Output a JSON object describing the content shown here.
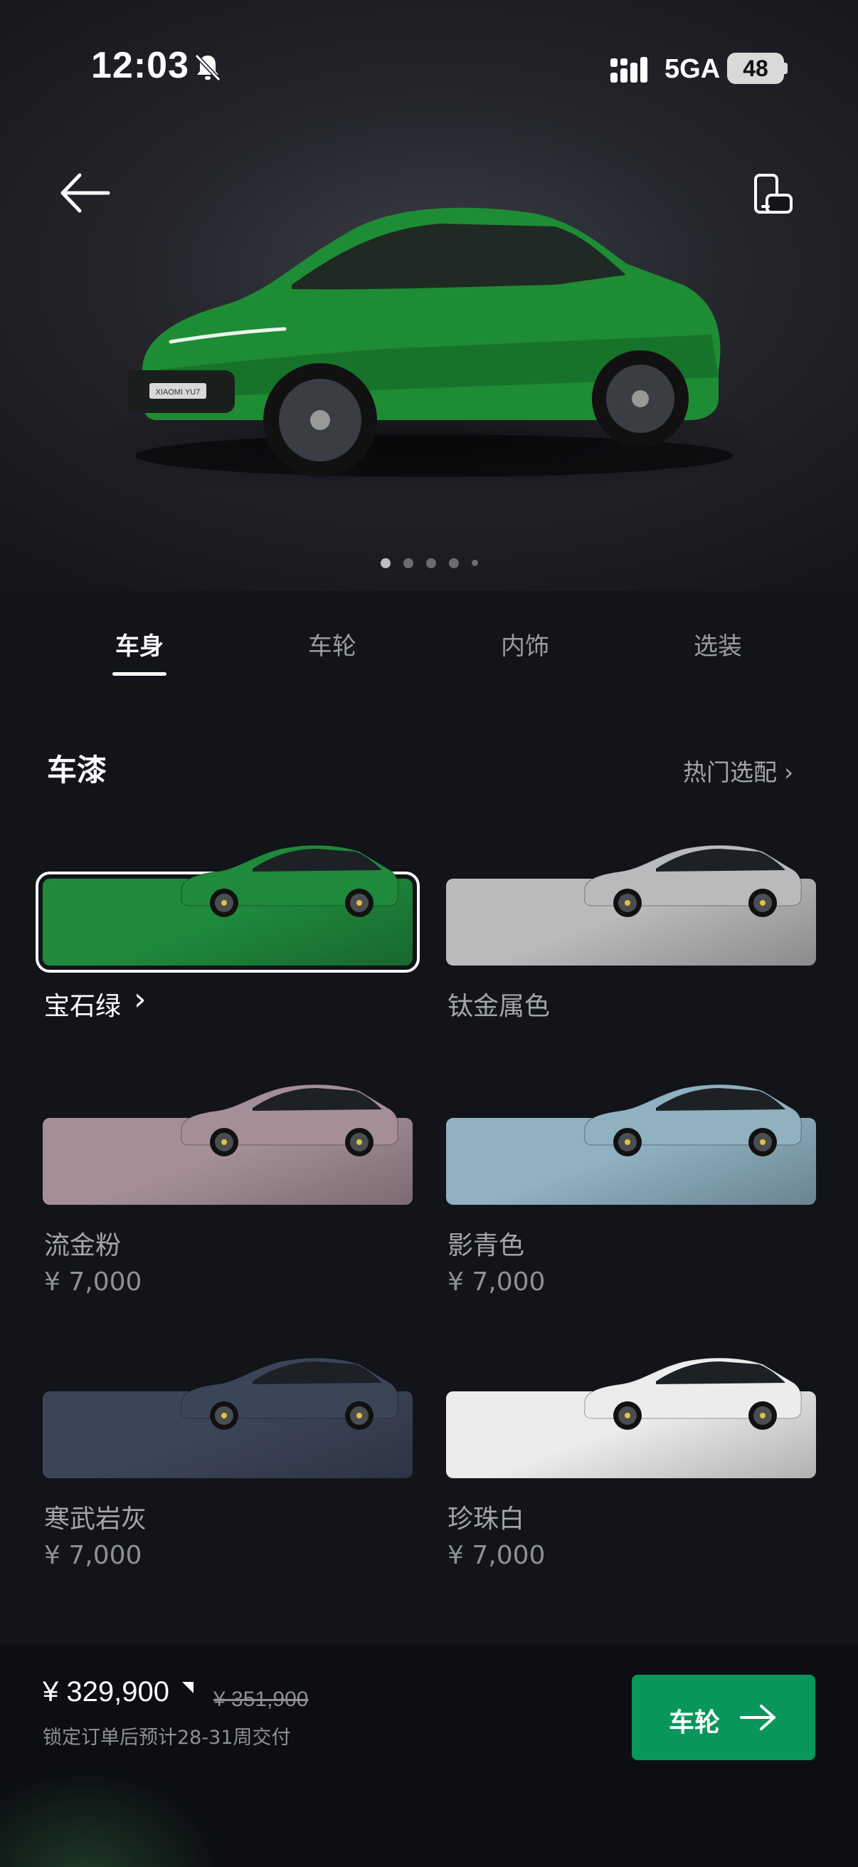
{
  "status_bar": {
    "time": "12:03",
    "network": "5GA",
    "battery": "48"
  },
  "hero": {
    "image_label": "XIAOMI YU7",
    "carousel_pages": 5,
    "carousel_active": 1
  },
  "tabs": [
    {
      "label": "车身",
      "active": true
    },
    {
      "label": "车轮",
      "active": false
    },
    {
      "label": "内饰",
      "active": false
    },
    {
      "label": "选装",
      "active": false
    }
  ],
  "paint": {
    "title": "车漆",
    "popular_link": "热门选配",
    "swatches": [
      {
        "name": "宝石绿",
        "price": "",
        "selected": true,
        "color": "#1f8a3c"
      },
      {
        "name": "钛金属色",
        "price": "",
        "selected": false,
        "color": "#b9babc"
      },
      {
        "name": "流金粉",
        "price": "¥ 7,000",
        "selected": false,
        "color": "#a48f98"
      },
      {
        "name": "影青色",
        "price": "¥ 7,000",
        "selected": false,
        "color": "#8fb1c0"
      },
      {
        "name": "寒武岩灰",
        "price": "¥ 7,000",
        "selected": false,
        "color": "#3c4558"
      },
      {
        "name": "珍珠白",
        "price": "¥ 7,000",
        "selected": false,
        "color": "#ececec"
      }
    ]
  },
  "footer": {
    "price": "¥ 329,900",
    "old_price": "¥ 351,900",
    "delivery": "锁定订单后预计28-31周交付",
    "next_label": "车轮"
  },
  "colors": {
    "accent": "#08965a",
    "background": "#12141a"
  }
}
